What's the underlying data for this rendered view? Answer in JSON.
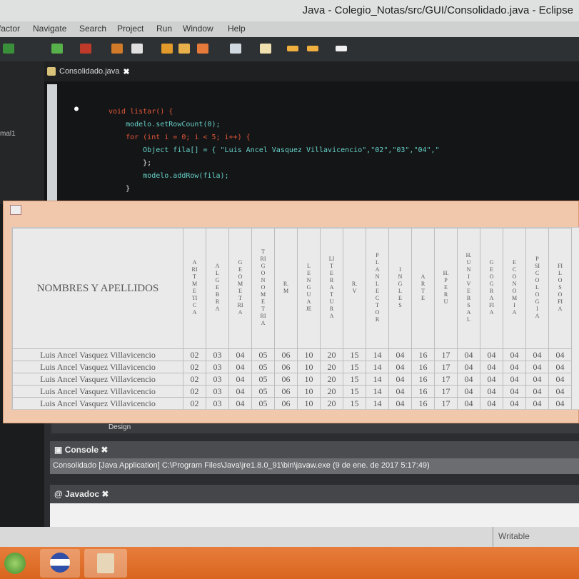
{
  "window": {
    "title": "Java - Colegio_Notas/src/GUI/Consolidado.java - Eclipse"
  },
  "menu": [
    "factor",
    "Navigate",
    "Search",
    "Project",
    "Run",
    "Window",
    "Help"
  ],
  "editor": {
    "tab_label": "Consolidado.java",
    "code_lines": [
      "void listar() {",
      "    modelo.setRowCount(0);",
      "    for (int i = 0; i < 5; i++) {",
      "        Object fila[] = { \"Luis Ancel Vasquez Villavicencio\",\"02\",\"03\",\"04\",\"",
      "        };",
      "        modelo.addRow(fila);",
      "    }"
    ]
  },
  "table": {
    "name_header": "NOMBRES Y APELLIDOS",
    "subjects": [
      "ARITMETICA",
      "ALGEBRA",
      "GEOMETRIA",
      "TRIGONOMETRIA",
      "R.M",
      "LENGUAJE",
      "LITERATURA",
      "R.V",
      "PLAN LECTOR",
      "INGLES",
      "ARTE",
      "H.PERU",
      "H.UNIVERSAL",
      "GEOGRAFIA",
      "ECONOMIA",
      "PSICOLOGIA",
      "FILOSOFIA"
    ],
    "rows": [
      {
        "name": "Luis Ancel Vasquez Villavicencio",
        "grades": [
          "02",
          "03",
          "04",
          "05",
          "06",
          "10",
          "20",
          "15",
          "14",
          "04",
          "16",
          "17",
          "04",
          "04",
          "04",
          "04",
          "04"
        ]
      },
      {
        "name": "Luis Ancel Vasquez Villavicencio",
        "grades": [
          "02",
          "03",
          "04",
          "05",
          "06",
          "10",
          "20",
          "15",
          "14",
          "04",
          "16",
          "17",
          "04",
          "04",
          "04",
          "04",
          "04"
        ]
      },
      {
        "name": "Luis Ancel Vasquez Villavicencio",
        "grades": [
          "02",
          "03",
          "04",
          "05",
          "06",
          "10",
          "20",
          "15",
          "14",
          "04",
          "16",
          "17",
          "04",
          "04",
          "04",
          "04",
          "04"
        ]
      },
      {
        "name": "Luis Ancel Vasquez Villavicencio",
        "grades": [
          "02",
          "03",
          "04",
          "05",
          "06",
          "10",
          "20",
          "15",
          "14",
          "04",
          "16",
          "17",
          "04",
          "04",
          "04",
          "04",
          "04"
        ]
      },
      {
        "name": "Luis Ancel Vasquez Villavicencio",
        "grades": [
          "02",
          "03",
          "04",
          "05",
          "06",
          "10",
          "20",
          "15",
          "14",
          "04",
          "16",
          "17",
          "04",
          "04",
          "04",
          "04",
          "04"
        ]
      }
    ]
  },
  "panels": {
    "design_tab": "Design",
    "console_tab": "Console",
    "console_line": "Consolidado [Java Application] C:\\Program Files\\Java\\jre1.8.0_91\\bin\\javaw.exe (9 de ene. de 2017 5:17:49)",
    "javadoc_tab": "Javadoc",
    "status_writable": "Writable",
    "left_label": "mal1"
  },
  "colors": {
    "dialog_bg": "#f2c8ad",
    "taskbar": "#e0702c",
    "editor_bg": "#141516"
  }
}
